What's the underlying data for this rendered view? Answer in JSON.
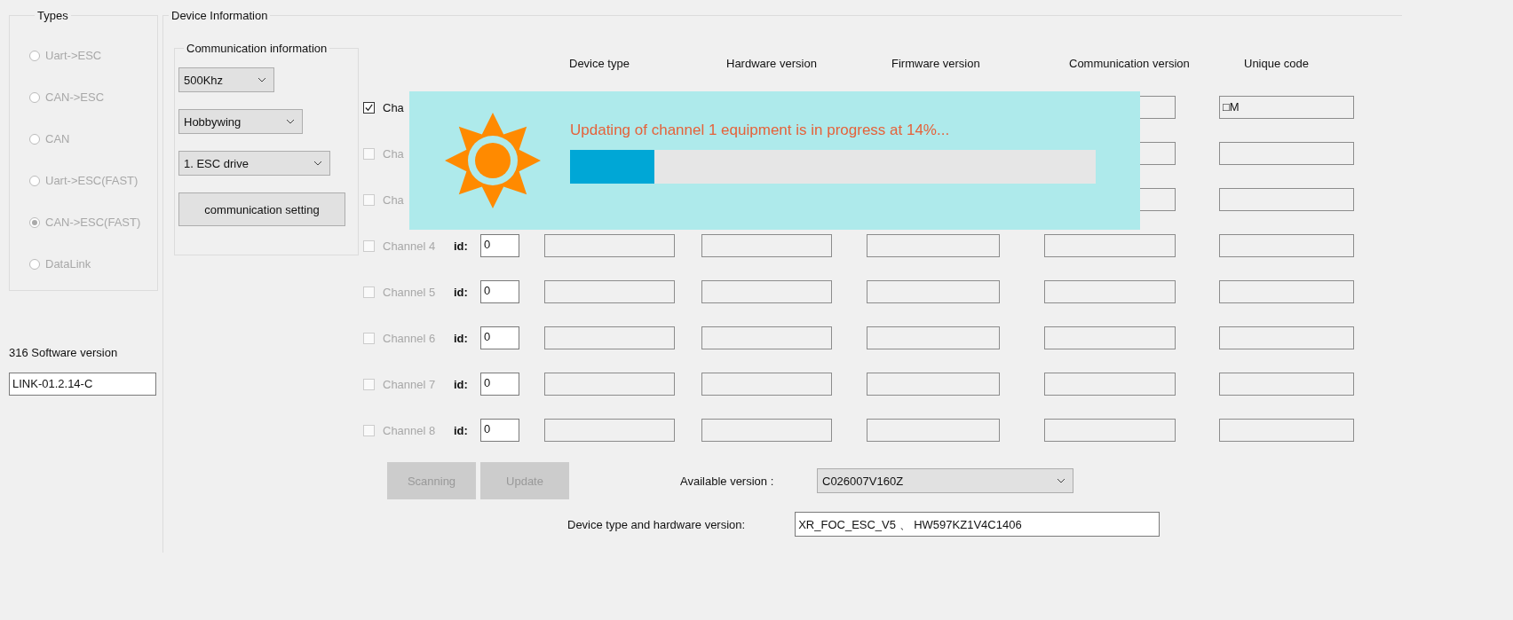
{
  "types": {
    "title": "Types",
    "options": [
      {
        "label": "Uart->ESC",
        "selected": false,
        "disabled": true
      },
      {
        "label": "CAN->ESC",
        "selected": false,
        "disabled": true
      },
      {
        "label": "CAN",
        "selected": false,
        "disabled": true
      },
      {
        "label": "Uart->ESC(FAST)",
        "selected": false,
        "disabled": true
      },
      {
        "label": "CAN->ESC(FAST)",
        "selected": true,
        "disabled": true
      },
      {
        "label": "DataLink",
        "selected": false,
        "disabled": true
      }
    ]
  },
  "software": {
    "label": "316 Software version",
    "value": "LINK-01.2.14-C"
  },
  "device_info": {
    "title": "Device Information",
    "communication": {
      "title": "Communication information",
      "dropdowns": [
        {
          "value": "500Khz"
        },
        {
          "value": "Hobbywing"
        },
        {
          "value": "1. ESC drive"
        }
      ],
      "button": "communication setting"
    },
    "columns": [
      "Device type",
      "Hardware version",
      "Firmware version",
      "Communication version",
      "Unique code"
    ],
    "channels": [
      {
        "label": "Cha",
        "checked": true,
        "disabled": false,
        "covered": true,
        "unique_code": "□M"
      },
      {
        "label": "Cha",
        "checked": false,
        "disabled": true,
        "covered": true
      },
      {
        "label": "Cha",
        "checked": false,
        "disabled": true,
        "covered": true
      },
      {
        "label": "Channel 4",
        "checked": false,
        "disabled": true,
        "covered": false,
        "id_label": "id:",
        "id": "0"
      },
      {
        "label": "Channel 5",
        "checked": false,
        "disabled": true,
        "covered": false,
        "id_label": "id:",
        "id": "0"
      },
      {
        "label": "Channel 6",
        "checked": false,
        "disabled": true,
        "covered": false,
        "id_label": "id:",
        "id": "0"
      },
      {
        "label": "Channel 7",
        "checked": false,
        "disabled": true,
        "covered": false,
        "id_label": "id:",
        "id": "0"
      },
      {
        "label": "Channel 8",
        "checked": false,
        "disabled": true,
        "covered": false,
        "id_label": "id:",
        "id": "0"
      }
    ],
    "buttons": [
      {
        "label": "Scanning",
        "disabled": true
      },
      {
        "label": "Update",
        "disabled": true
      }
    ],
    "available_version": {
      "label": "Available version :",
      "value": "C026007V160Z"
    },
    "device_hw": {
      "label": "Device type and hardware version:",
      "value": "XR_FOC_ESC_V5 、 HW597KZ1V4C1406"
    }
  },
  "progress": {
    "message": "Updating of channel 1 equipment is in progress at 14%...",
    "level": 0.16
  }
}
